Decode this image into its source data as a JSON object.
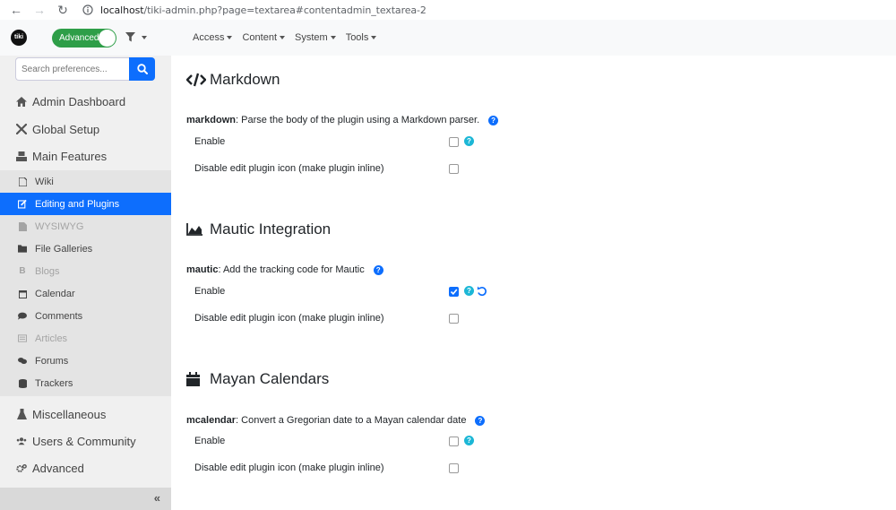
{
  "browser": {
    "url_host": "localhost",
    "url_path": "/tiki-admin.php?page=textarea#contentadmin_textarea-2"
  },
  "topnav": {
    "logo_text": "tiki",
    "mode_toggle_label": "Advanced",
    "menus": [
      "Access",
      "Content",
      "System",
      "Tools"
    ]
  },
  "sidebar": {
    "search_placeholder": "Search preferences...",
    "sections": [
      {
        "label": "Admin Dashboard",
        "icon": "home-icon"
      },
      {
        "label": "Global Setup",
        "icon": "tools-icon"
      },
      {
        "label": "Main Features",
        "icon": "features-icon"
      }
    ],
    "features": [
      {
        "label": "Wiki",
        "icon": "file-icon",
        "state": "normal"
      },
      {
        "label": "Editing and Plugins",
        "icon": "edit-icon",
        "state": "active"
      },
      {
        "label": "WYSIWYG",
        "icon": "file-icon",
        "state": "disabled"
      },
      {
        "label": "File Galleries",
        "icon": "folder-icon",
        "state": "normal"
      },
      {
        "label": "Blogs",
        "icon": "bitcoin-icon",
        "state": "disabled"
      },
      {
        "label": "Calendar",
        "icon": "calendar-icon",
        "state": "normal"
      },
      {
        "label": "Comments",
        "icon": "comment-icon",
        "state": "normal"
      },
      {
        "label": "Articles",
        "icon": "newspaper-icon",
        "state": "disabled"
      },
      {
        "label": "Forums",
        "icon": "comments-icon",
        "state": "normal"
      },
      {
        "label": "Trackers",
        "icon": "database-icon",
        "state": "normal"
      }
    ],
    "more_sections": [
      {
        "label": "Miscellaneous",
        "icon": "flask-icon"
      },
      {
        "label": "Users & Community",
        "icon": "users-icon"
      },
      {
        "label": "Advanced",
        "icon": "cogs-icon"
      }
    ],
    "collapse_glyph": "«"
  },
  "main": {
    "sections": [
      {
        "title": "Markdown",
        "icon": "code-icon",
        "pref_name": "markdown",
        "pref_desc": ": Parse the body of the plugin using a Markdown parser.",
        "enable_label": "Enable",
        "enable_checked": false,
        "enable_has_reset": false,
        "inline_label": "Disable edit plugin icon (make plugin inline)",
        "inline_checked": false
      },
      {
        "title": "Mautic Integration",
        "icon": "area-chart-icon",
        "pref_name": "mautic",
        "pref_desc": ": Add the tracking code for Mautic",
        "enable_label": "Enable",
        "enable_checked": true,
        "enable_has_reset": true,
        "inline_label": "Disable edit plugin icon (make plugin inline)",
        "inline_checked": false
      },
      {
        "title": "Mayan Calendars",
        "icon": "calendar-icon",
        "pref_name": "mcalendar",
        "pref_desc": ": Convert a Gregorian date to a Mayan calendar date",
        "enable_label": "Enable",
        "enable_checked": false,
        "enable_has_reset": false,
        "inline_label": "Disable edit plugin icon (make plugin inline)",
        "inline_checked": false
      }
    ],
    "help_glyph": "?"
  },
  "colors": {
    "primary": "#0d6efd",
    "toggle_green": "#2e9e48",
    "info": "#1cb7d6",
    "sidebar_bg": "#f0f0f0"
  }
}
